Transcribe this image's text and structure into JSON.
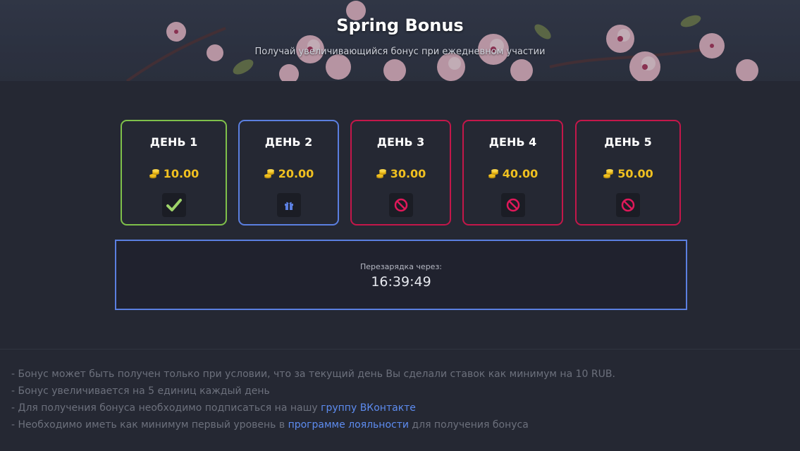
{
  "banner": {
    "title": "Spring Bonus",
    "subtitle": "Получай увеличивающийся бонус при ежедневном участии"
  },
  "colors": {
    "background": "#252833",
    "claimed": "#7fc04a",
    "available": "#5b7fe0",
    "locked": "#c4174a",
    "coin": "#f0c020",
    "link": "#5d8cf0"
  },
  "days": [
    {
      "label": "ДЕНЬ 1",
      "amount": "10.00",
      "status": "claimed",
      "icon": "checkmark-icon"
    },
    {
      "label": "ДЕНЬ 2",
      "amount": "20.00",
      "status": "available",
      "icon": "gift-icon"
    },
    {
      "label": "ДЕНЬ 3",
      "amount": "30.00",
      "status": "locked",
      "icon": "prohibited-icon"
    },
    {
      "label": "ДЕНЬ 4",
      "amount": "40.00",
      "status": "locked",
      "icon": "prohibited-icon"
    },
    {
      "label": "ДЕНЬ 5",
      "amount": "50.00",
      "status": "locked",
      "icon": "prohibited-icon"
    }
  ],
  "timer": {
    "label": "Перезарядка через:",
    "value": "16:39:49"
  },
  "rules": {
    "rule1": "- Бонус может быть получен только при условии, что за текущий день Вы сделали ставок как минимум на 10 RUB.",
    "rule2": "- Бонус увеличивается на 5 единиц каждый день",
    "rule3_text": "- Для получения бонуса необходимо подписаться на нашу ",
    "rule3_link": "группу ВКонтакте",
    "rule4_text": "- Необходимо иметь как минимум первый уровень в ",
    "rule4_link": "программе лояльности",
    "rule4_suffix": " для получения бонуса"
  }
}
